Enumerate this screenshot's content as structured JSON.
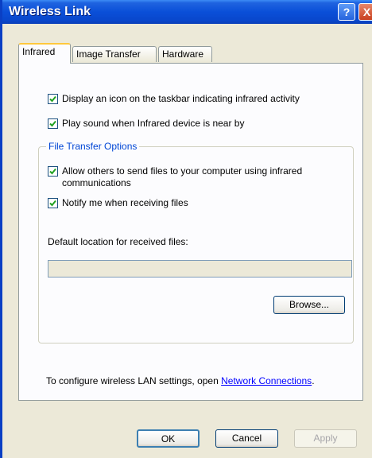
{
  "window": {
    "title": "Wireless Link",
    "help_label": "?",
    "close_label": "X"
  },
  "tabs": [
    {
      "label": "Infrared",
      "active": true
    },
    {
      "label": "Image Transfer",
      "active": false
    },
    {
      "label": "Hardware",
      "active": false
    }
  ],
  "options": {
    "taskbar_icon": {
      "label": "Display an icon on the taskbar indicating infrared activity",
      "checked": true
    },
    "play_sound": {
      "label": "Play sound when Infrared device is near by",
      "checked": true
    }
  },
  "file_transfer": {
    "group_title": "File Transfer Options",
    "allow_send": {
      "label_line1": "Allow others to send files to your computer using infrared",
      "label_line2": "communications",
      "checked": true
    },
    "notify": {
      "label": "Notify me when receiving files",
      "checked": true
    },
    "location_label": "Default location for received files:",
    "location_value": "",
    "browse_label": "Browse..."
  },
  "footer": {
    "text": "To configure wireless LAN settings, open ",
    "link": "Network Connections",
    "suffix": "."
  },
  "buttons": {
    "ok": "OK",
    "cancel": "Cancel",
    "apply": "Apply"
  },
  "colors": {
    "titlebar": "#0a4fd8",
    "tab_highlight": "#ffc83c",
    "group_title": "#0046d5",
    "link": "#0000ff"
  }
}
